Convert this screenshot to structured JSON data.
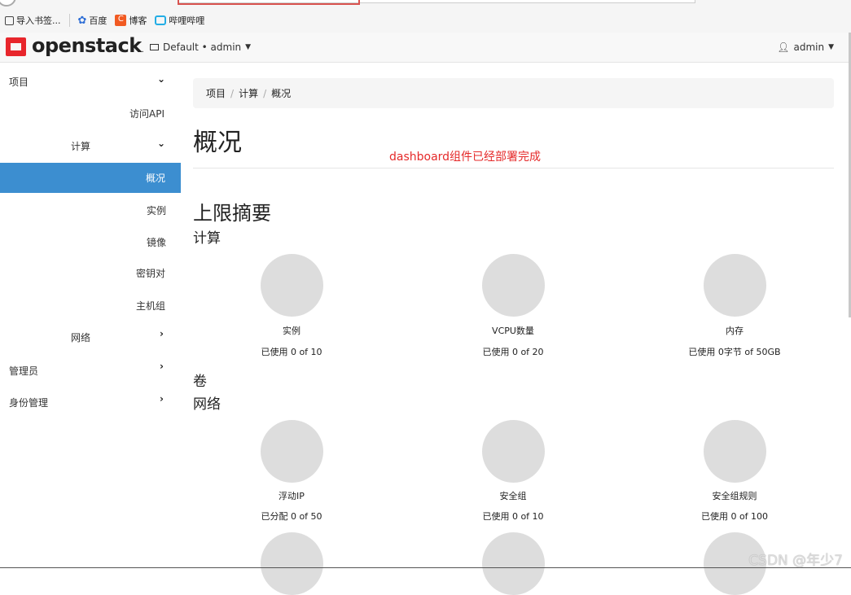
{
  "bookmarks": [
    {
      "label": "导入书签...",
      "color": "#4a4a4a"
    },
    {
      "label": "百度",
      "color": "#2f6fd6"
    },
    {
      "label": "博客",
      "color": "#f15a22"
    },
    {
      "label": "哔哩哔哩",
      "color": "#23ade5"
    }
  ],
  "header": {
    "logo": "openstack",
    "logo_suffix": ".",
    "project": "Default • admin",
    "user": "admin"
  },
  "sidebar": {
    "project": "项目",
    "access_api": "访问API",
    "compute": "计算",
    "overview": "概况",
    "instances": "实例",
    "images": "镜像",
    "keypairs": "密钥对",
    "server_groups": "主机组",
    "network": "网络",
    "admin": "管理员",
    "identity": "身份管理"
  },
  "breadcrumb": {
    "project": "项目",
    "compute": "计算",
    "overview": "概况"
  },
  "page_title": "概况",
  "annotation": "dashboard组件已经部署完成",
  "limits_title": "上限摘要",
  "sections": {
    "compute": "计算",
    "volume": "卷",
    "network": "网络"
  },
  "charts": [
    {
      "label": "实例",
      "usage": "已使用 0 of 10"
    },
    {
      "label": "VCPU数量",
      "usage": "已使用 0 of 20"
    },
    {
      "label": "内存",
      "usage": "已使用 0字节 of 50GB"
    },
    {
      "label": "浮动IP",
      "usage": "已分配 0 of 50"
    },
    {
      "label": "安全组",
      "usage": "已使用 0 of 10"
    },
    {
      "label": "安全组规则",
      "usage": "已使用 0 of 100"
    }
  ],
  "watermark": "CSDN @年少7",
  "colors": {
    "accent": "#3c8ed0",
    "brand": "#e8262c",
    "annotation": "#e52a2a",
    "pie": "#dddddd"
  }
}
